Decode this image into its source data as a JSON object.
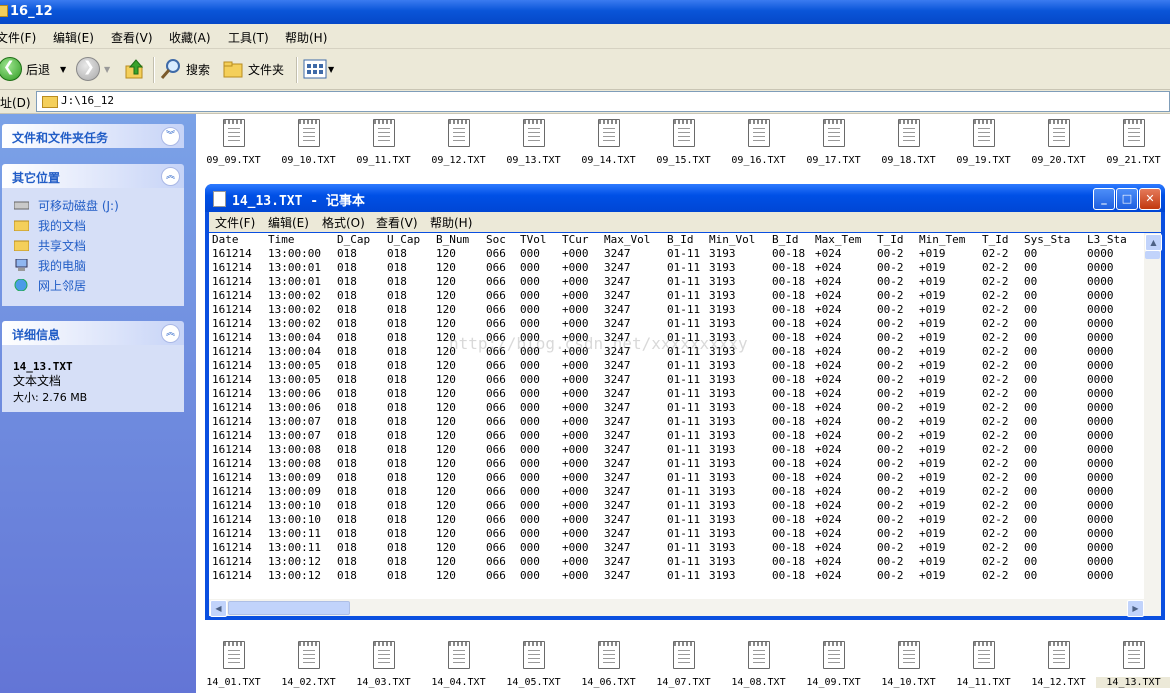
{
  "explorer": {
    "title": "16_12",
    "menu": [
      "文件(F)",
      "编辑(E)",
      "查看(V)",
      "收藏(A)",
      "工具(T)",
      "帮助(H)"
    ],
    "toolbar": {
      "back": "后退",
      "search": "搜索",
      "folders": "文件夹"
    },
    "address": {
      "label": "址(D)",
      "path": "J:\\16_12"
    }
  },
  "taskpane": {
    "tasks_title": "文件和文件夹任务",
    "places_title": "其它位置",
    "places": [
      "可移动磁盘 (J:)",
      "我的文档",
      "共享文档",
      "我的电脑",
      "网上邻居"
    ],
    "details_title": "详细信息",
    "details": {
      "name": "14_13.TXT",
      "type": "文本文档",
      "size": "大小: 2.76 MB"
    }
  },
  "top_files": [
    "09_09.TXT",
    "09_10.TXT",
    "09_11.TXT",
    "09_12.TXT",
    "09_13.TXT",
    "09_14.TXT",
    "09_15.TXT",
    "09_16.TXT",
    "09_17.TXT",
    "09_18.TXT",
    "09_19.TXT",
    "09_20.TXT",
    "09_21.TXT"
  ],
  "bottom_files": [
    "14_01.TXT",
    "14_02.TXT",
    "14_03.TXT",
    "14_04.TXT",
    "14_05.TXT",
    "14_06.TXT",
    "14_07.TXT",
    "14_08.TXT",
    "14_09.TXT",
    "14_10.TXT",
    "14_11.TXT",
    "14_12.TXT",
    "14_13.TXT"
  ],
  "notepad": {
    "title": "14_13.TXT - 记事本",
    "menu": [
      "文件(F)",
      "编辑(E)",
      "格式(O)",
      "查看(V)",
      "帮助(H)"
    ],
    "watermark": "http://blog.csdn.net/xxxxxxxxxy",
    "columns": [
      "Date",
      "Time",
      "D_Cap",
      "U_Cap",
      "B_Num",
      "Soc",
      "TVol",
      "TCur",
      "Max_Vol",
      "B_Id",
      "Min_Vol",
      "B_Id",
      "Max_Tem",
      "T_Id",
      "Min_Tem",
      "T_Id",
      "Sys_Sta",
      "L3_Sta"
    ],
    "rows": [
      [
        "161214",
        "13:00:00",
        "018",
        "018",
        "120",
        "066",
        "000",
        "+000",
        "3247",
        "01-11",
        "3193",
        "00-18",
        "+024",
        "00-2",
        "+019",
        "02-2",
        "00",
        "0000"
      ],
      [
        "161214",
        "13:00:01",
        "018",
        "018",
        "120",
        "066",
        "000",
        "+000",
        "3247",
        "01-11",
        "3193",
        "00-18",
        "+024",
        "00-2",
        "+019",
        "02-2",
        "00",
        "0000"
      ],
      [
        "161214",
        "13:00:01",
        "018",
        "018",
        "120",
        "066",
        "000",
        "+000",
        "3247",
        "01-11",
        "3193",
        "00-18",
        "+024",
        "00-2",
        "+019",
        "02-2",
        "00",
        "0000"
      ],
      [
        "161214",
        "13:00:02",
        "018",
        "018",
        "120",
        "066",
        "000",
        "+000",
        "3247",
        "01-11",
        "3193",
        "00-18",
        "+024",
        "00-2",
        "+019",
        "02-2",
        "00",
        "0000"
      ],
      [
        "161214",
        "13:00:02",
        "018",
        "018",
        "120",
        "066",
        "000",
        "+000",
        "3247",
        "01-11",
        "3193",
        "00-18",
        "+024",
        "00-2",
        "+019",
        "02-2",
        "00",
        "0000"
      ],
      [
        "161214",
        "13:00:02",
        "018",
        "018",
        "120",
        "066",
        "000",
        "+000",
        "3247",
        "01-11",
        "3193",
        "00-18",
        "+024",
        "00-2",
        "+019",
        "02-2",
        "00",
        "0000"
      ],
      [
        "161214",
        "13:00:04",
        "018",
        "018",
        "120",
        "066",
        "000",
        "+000",
        "3247",
        "01-11",
        "3193",
        "00-18",
        "+024",
        "00-2",
        "+019",
        "02-2",
        "00",
        "0000"
      ],
      [
        "161214",
        "13:00:04",
        "018",
        "018",
        "120",
        "066",
        "000",
        "+000",
        "3247",
        "01-11",
        "3193",
        "00-18",
        "+024",
        "00-2",
        "+019",
        "02-2",
        "00",
        "0000"
      ],
      [
        "161214",
        "13:00:05",
        "018",
        "018",
        "120",
        "066",
        "000",
        "+000",
        "3247",
        "01-11",
        "3193",
        "00-18",
        "+024",
        "00-2",
        "+019",
        "02-2",
        "00",
        "0000"
      ],
      [
        "161214",
        "13:00:05",
        "018",
        "018",
        "120",
        "066",
        "000",
        "+000",
        "3247",
        "01-11",
        "3193",
        "00-18",
        "+024",
        "00-2",
        "+019",
        "02-2",
        "00",
        "0000"
      ],
      [
        "161214",
        "13:00:06",
        "018",
        "018",
        "120",
        "066",
        "000",
        "+000",
        "3247",
        "01-11",
        "3193",
        "00-18",
        "+024",
        "00-2",
        "+019",
        "02-2",
        "00",
        "0000"
      ],
      [
        "161214",
        "13:00:06",
        "018",
        "018",
        "120",
        "066",
        "000",
        "+000",
        "3247",
        "01-11",
        "3193",
        "00-18",
        "+024",
        "00-2",
        "+019",
        "02-2",
        "00",
        "0000"
      ],
      [
        "161214",
        "13:00:07",
        "018",
        "018",
        "120",
        "066",
        "000",
        "+000",
        "3247",
        "01-11",
        "3193",
        "00-18",
        "+024",
        "00-2",
        "+019",
        "02-2",
        "00",
        "0000"
      ],
      [
        "161214",
        "13:00:07",
        "018",
        "018",
        "120",
        "066",
        "000",
        "+000",
        "3247",
        "01-11",
        "3193",
        "00-18",
        "+024",
        "00-2",
        "+019",
        "02-2",
        "00",
        "0000"
      ],
      [
        "161214",
        "13:00:08",
        "018",
        "018",
        "120",
        "066",
        "000",
        "+000",
        "3247",
        "01-11",
        "3193",
        "00-18",
        "+024",
        "00-2",
        "+019",
        "02-2",
        "00",
        "0000"
      ],
      [
        "161214",
        "13:00:08",
        "018",
        "018",
        "120",
        "066",
        "000",
        "+000",
        "3247",
        "01-11",
        "3193",
        "00-18",
        "+024",
        "00-2",
        "+019",
        "02-2",
        "00",
        "0000"
      ],
      [
        "161214",
        "13:00:09",
        "018",
        "018",
        "120",
        "066",
        "000",
        "+000",
        "3247",
        "01-11",
        "3193",
        "00-18",
        "+024",
        "00-2",
        "+019",
        "02-2",
        "00",
        "0000"
      ],
      [
        "161214",
        "13:00:09",
        "018",
        "018",
        "120",
        "066",
        "000",
        "+000",
        "3247",
        "01-11",
        "3193",
        "00-18",
        "+024",
        "00-2",
        "+019",
        "02-2",
        "00",
        "0000"
      ],
      [
        "161214",
        "13:00:10",
        "018",
        "018",
        "120",
        "066",
        "000",
        "+000",
        "3247",
        "01-11",
        "3193",
        "00-18",
        "+024",
        "00-2",
        "+019",
        "02-2",
        "00",
        "0000"
      ],
      [
        "161214",
        "13:00:10",
        "018",
        "018",
        "120",
        "066",
        "000",
        "+000",
        "3247",
        "01-11",
        "3193",
        "00-18",
        "+024",
        "00-2",
        "+019",
        "02-2",
        "00",
        "0000"
      ],
      [
        "161214",
        "13:00:11",
        "018",
        "018",
        "120",
        "066",
        "000",
        "+000",
        "3247",
        "01-11",
        "3193",
        "00-18",
        "+024",
        "00-2",
        "+019",
        "02-2",
        "00",
        "0000"
      ],
      [
        "161214",
        "13:00:11",
        "018",
        "018",
        "120",
        "066",
        "000",
        "+000",
        "3247",
        "01-11",
        "3193",
        "00-18",
        "+024",
        "00-2",
        "+019",
        "02-2",
        "00",
        "0000"
      ],
      [
        "161214",
        "13:00:12",
        "018",
        "018",
        "120",
        "066",
        "000",
        "+000",
        "3247",
        "01-11",
        "3193",
        "00-18",
        "+024",
        "00-2",
        "+019",
        "02-2",
        "00",
        "0000"
      ],
      [
        "161214",
        "13:00:12",
        "018",
        "018",
        "120",
        "066",
        "000",
        "+000",
        "3247",
        "01-11",
        "3193",
        "00-18",
        "+024",
        "00-2",
        "+019",
        "02-2",
        "00",
        "0000"
      ]
    ]
  }
}
